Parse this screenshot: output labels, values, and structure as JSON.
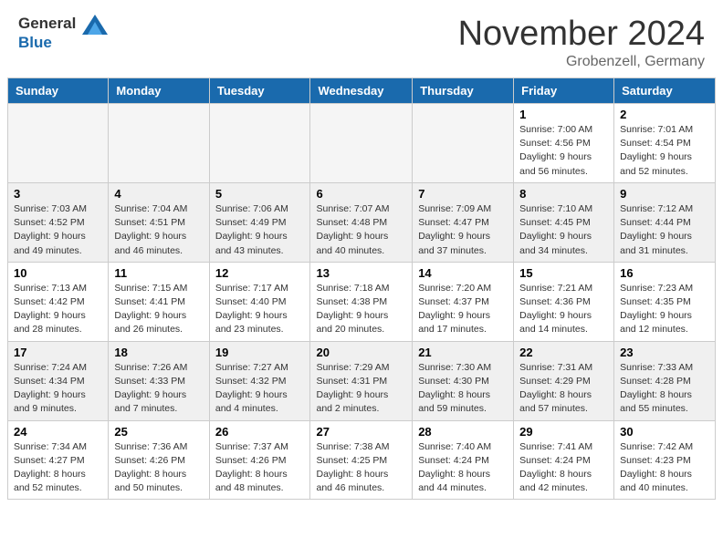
{
  "header": {
    "logo_general": "General",
    "logo_blue": "Blue",
    "month_title": "November 2024",
    "location": "Grobenzell, Germany"
  },
  "days_of_week": [
    "Sunday",
    "Monday",
    "Tuesday",
    "Wednesday",
    "Thursday",
    "Friday",
    "Saturday"
  ],
  "weeks": [
    [
      {
        "day": "",
        "empty": true
      },
      {
        "day": "",
        "empty": true
      },
      {
        "day": "",
        "empty": true
      },
      {
        "day": "",
        "empty": true
      },
      {
        "day": "",
        "empty": true
      },
      {
        "day": "1",
        "sunrise": "Sunrise: 7:00 AM",
        "sunset": "Sunset: 4:56 PM",
        "daylight": "Daylight: 9 hours and 56 minutes."
      },
      {
        "day": "2",
        "sunrise": "Sunrise: 7:01 AM",
        "sunset": "Sunset: 4:54 PM",
        "daylight": "Daylight: 9 hours and 52 minutes."
      }
    ],
    [
      {
        "day": "3",
        "sunrise": "Sunrise: 7:03 AM",
        "sunset": "Sunset: 4:52 PM",
        "daylight": "Daylight: 9 hours and 49 minutes."
      },
      {
        "day": "4",
        "sunrise": "Sunrise: 7:04 AM",
        "sunset": "Sunset: 4:51 PM",
        "daylight": "Daylight: 9 hours and 46 minutes."
      },
      {
        "day": "5",
        "sunrise": "Sunrise: 7:06 AM",
        "sunset": "Sunset: 4:49 PM",
        "daylight": "Daylight: 9 hours and 43 minutes."
      },
      {
        "day": "6",
        "sunrise": "Sunrise: 7:07 AM",
        "sunset": "Sunset: 4:48 PM",
        "daylight": "Daylight: 9 hours and 40 minutes."
      },
      {
        "day": "7",
        "sunrise": "Sunrise: 7:09 AM",
        "sunset": "Sunset: 4:47 PM",
        "daylight": "Daylight: 9 hours and 37 minutes."
      },
      {
        "day": "8",
        "sunrise": "Sunrise: 7:10 AM",
        "sunset": "Sunset: 4:45 PM",
        "daylight": "Daylight: 9 hours and 34 minutes."
      },
      {
        "day": "9",
        "sunrise": "Sunrise: 7:12 AM",
        "sunset": "Sunset: 4:44 PM",
        "daylight": "Daylight: 9 hours and 31 minutes."
      }
    ],
    [
      {
        "day": "10",
        "sunrise": "Sunrise: 7:13 AM",
        "sunset": "Sunset: 4:42 PM",
        "daylight": "Daylight: 9 hours and 28 minutes."
      },
      {
        "day": "11",
        "sunrise": "Sunrise: 7:15 AM",
        "sunset": "Sunset: 4:41 PM",
        "daylight": "Daylight: 9 hours and 26 minutes."
      },
      {
        "day": "12",
        "sunrise": "Sunrise: 7:17 AM",
        "sunset": "Sunset: 4:40 PM",
        "daylight": "Daylight: 9 hours and 23 minutes."
      },
      {
        "day": "13",
        "sunrise": "Sunrise: 7:18 AM",
        "sunset": "Sunset: 4:38 PM",
        "daylight": "Daylight: 9 hours and 20 minutes."
      },
      {
        "day": "14",
        "sunrise": "Sunrise: 7:20 AM",
        "sunset": "Sunset: 4:37 PM",
        "daylight": "Daylight: 9 hours and 17 minutes."
      },
      {
        "day": "15",
        "sunrise": "Sunrise: 7:21 AM",
        "sunset": "Sunset: 4:36 PM",
        "daylight": "Daylight: 9 hours and 14 minutes."
      },
      {
        "day": "16",
        "sunrise": "Sunrise: 7:23 AM",
        "sunset": "Sunset: 4:35 PM",
        "daylight": "Daylight: 9 hours and 12 minutes."
      }
    ],
    [
      {
        "day": "17",
        "sunrise": "Sunrise: 7:24 AM",
        "sunset": "Sunset: 4:34 PM",
        "daylight": "Daylight: 9 hours and 9 minutes."
      },
      {
        "day": "18",
        "sunrise": "Sunrise: 7:26 AM",
        "sunset": "Sunset: 4:33 PM",
        "daylight": "Daylight: 9 hours and 7 minutes."
      },
      {
        "day": "19",
        "sunrise": "Sunrise: 7:27 AM",
        "sunset": "Sunset: 4:32 PM",
        "daylight": "Daylight: 9 hours and 4 minutes."
      },
      {
        "day": "20",
        "sunrise": "Sunrise: 7:29 AM",
        "sunset": "Sunset: 4:31 PM",
        "daylight": "Daylight: 9 hours and 2 minutes."
      },
      {
        "day": "21",
        "sunrise": "Sunrise: 7:30 AM",
        "sunset": "Sunset: 4:30 PM",
        "daylight": "Daylight: 8 hours and 59 minutes."
      },
      {
        "day": "22",
        "sunrise": "Sunrise: 7:31 AM",
        "sunset": "Sunset: 4:29 PM",
        "daylight": "Daylight: 8 hours and 57 minutes."
      },
      {
        "day": "23",
        "sunrise": "Sunrise: 7:33 AM",
        "sunset": "Sunset: 4:28 PM",
        "daylight": "Daylight: 8 hours and 55 minutes."
      }
    ],
    [
      {
        "day": "24",
        "sunrise": "Sunrise: 7:34 AM",
        "sunset": "Sunset: 4:27 PM",
        "daylight": "Daylight: 8 hours and 52 minutes."
      },
      {
        "day": "25",
        "sunrise": "Sunrise: 7:36 AM",
        "sunset": "Sunset: 4:26 PM",
        "daylight": "Daylight: 8 hours and 50 minutes."
      },
      {
        "day": "26",
        "sunrise": "Sunrise: 7:37 AM",
        "sunset": "Sunset: 4:26 PM",
        "daylight": "Daylight: 8 hours and 48 minutes."
      },
      {
        "day": "27",
        "sunrise": "Sunrise: 7:38 AM",
        "sunset": "Sunset: 4:25 PM",
        "daylight": "Daylight: 8 hours and 46 minutes."
      },
      {
        "day": "28",
        "sunrise": "Sunrise: 7:40 AM",
        "sunset": "Sunset: 4:24 PM",
        "daylight": "Daylight: 8 hours and 44 minutes."
      },
      {
        "day": "29",
        "sunrise": "Sunrise: 7:41 AM",
        "sunset": "Sunset: 4:24 PM",
        "daylight": "Daylight: 8 hours and 42 minutes."
      },
      {
        "day": "30",
        "sunrise": "Sunrise: 7:42 AM",
        "sunset": "Sunset: 4:23 PM",
        "daylight": "Daylight: 8 hours and 40 minutes."
      }
    ]
  ]
}
